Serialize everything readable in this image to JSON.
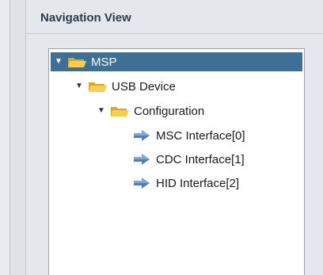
{
  "panel": {
    "title": "Navigation View"
  },
  "tree": {
    "nodes": [
      {
        "label": "MSP",
        "type": "folder",
        "expanded": true,
        "selected": true
      },
      {
        "label": "USB Device",
        "type": "folder",
        "expanded": true,
        "selected": false
      },
      {
        "label": "Configuration",
        "type": "folder",
        "expanded": true,
        "selected": false
      },
      {
        "label": "MSC Interface[0]",
        "type": "interface",
        "selected": false
      },
      {
        "label": "CDC Interface[1]",
        "type": "interface",
        "selected": false
      },
      {
        "label": "HID Interface[2]",
        "type": "interface",
        "selected": false
      }
    ]
  },
  "icons": {
    "expanded": "triangle-down-icon",
    "folder": "open-folder-icon",
    "interface": "arrow-right-icon"
  },
  "colors": {
    "selection": "#3d6f97",
    "folder": "#f5c842",
    "arrow": "#4a7fc1",
    "panel_bg": "#e4e7eb"
  }
}
